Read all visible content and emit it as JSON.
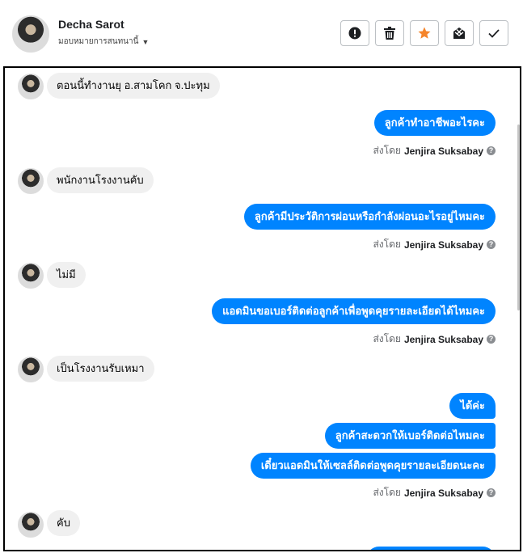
{
  "header": {
    "contact_name": "Decha Sarot",
    "assign_label": "มอบหมายการสนทนานี้",
    "actions": [
      {
        "name": "report",
        "icon": "exclamation-icon",
        "color": "#1c1e21"
      },
      {
        "name": "delete",
        "icon": "trash-icon",
        "color": "#1c1e21"
      },
      {
        "name": "star",
        "icon": "star-icon",
        "color": "#f5842a"
      },
      {
        "name": "mark-spam",
        "icon": "mail-x-icon",
        "color": "#1c1e21"
      },
      {
        "name": "mark-done",
        "icon": "check-icon",
        "color": "#1c1e21"
      }
    ]
  },
  "sent_by_prefix": "ส่งโดย",
  "agent_name": "Jenjira Suksabay",
  "messages": [
    {
      "dir": "in",
      "text": "ตอนนี้ทำงานยุ อ.สามโคก จ.ปะทุม"
    },
    {
      "dir": "out",
      "text": "ลูกค้าทำอาชีพอะไรคะ"
    },
    {
      "dir": "in",
      "text": "พนักงานโรงงานคับ"
    },
    {
      "dir": "out",
      "text": "ลูกค้ามีประวัติการผ่อนหรือกำลังผ่อนอะไรอยู่ไหมคะ"
    },
    {
      "dir": "in",
      "text": "ไม่มี"
    },
    {
      "dir": "out",
      "text": "แอดมินขอเบอร์ติดต่อลูกค้าเพื่อพูดคุยรายละเอียดได้ไหมคะ"
    },
    {
      "dir": "in",
      "text": "เป็นโรงงานรับเหมา"
    },
    {
      "dir": "out",
      "text": "ได้ค่ะ"
    },
    {
      "dir": "out",
      "text": "ลูกค้าสะดวกให้เบอร์ติดต่อไหมคะ"
    },
    {
      "dir": "out",
      "text": "เดี๋ยวแอดมินให้เซลล์ติดต่อพูดคุยรายละเอียดนะคะ"
    },
    {
      "dir": "in",
      "text": "คับ"
    }
  ],
  "colors": {
    "accent": "#0084ff",
    "incoming_bg": "#f0f0f0"
  }
}
